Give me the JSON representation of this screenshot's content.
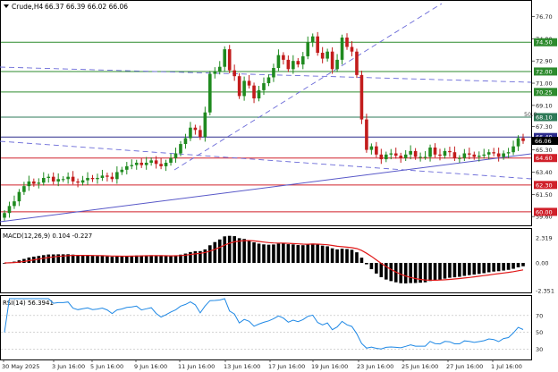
{
  "header": {
    "symbol": "Crude,H4",
    "ohlc": "66.37 66.39 66.02 66.06"
  },
  "main_axis": {
    "ticks": [
      "76.70",
      "74.80",
      "72.90",
      "71.00",
      "69.10",
      "67.30",
      "65.30",
      "63.40",
      "61.50",
      "59.60"
    ],
    "fibo_label": "50.0",
    "levels": [
      {
        "label": "74.50",
        "value": 74.5,
        "color": "#2e8b2e",
        "text_color": "#ffffff",
        "bg": "#2e8b2e"
      },
      {
        "label": "72.00",
        "value": 72.0,
        "color": "#2e8b2e",
        "text_color": "#ffffff",
        "bg": "#2e8b2e"
      },
      {
        "label": "70.25",
        "value": 70.25,
        "color": "#2e8b2e",
        "text_color": "#ffffff",
        "bg": "#2e8b2e"
      },
      {
        "label": "68.10",
        "value": 68.1,
        "color": "#2e7a58",
        "text_color": "#ffffff",
        "bg": "#2e7a58"
      },
      {
        "label": "66.40",
        "value": 66.4,
        "color": "#2b2b8c",
        "text_color": "#ffffff",
        "bg": "#2b2b8c"
      },
      {
        "label": "64.60",
        "value": 64.6,
        "color": "#d0202a",
        "text_color": "#ffffff",
        "bg": "#d0202a"
      },
      {
        "label": "62.30",
        "value": 62.3,
        "color": "#d0202a",
        "text_color": "#ffffff",
        "bg": "#d0202a"
      },
      {
        "label": "60.00",
        "value": 60.0,
        "color": "#d0202a",
        "text_color": "#ffffff",
        "bg": "#d0202a"
      }
    ],
    "current_price": "66.06"
  },
  "macd": {
    "title": "MACD(12,26,9) 0.104 -0.227",
    "ticks": [
      "2.319",
      "0.00",
      "-2.351"
    ]
  },
  "rsi": {
    "title": "RSI(14) 56.3941",
    "ticks": [
      "70",
      "50",
      "30"
    ]
  },
  "x_axis": {
    "labels": [
      "30 May 2025",
      "3 Jun 16:00",
      "5 Jun 16:00",
      "9 Jun 16:00",
      "11 Jun 16:00",
      "13 Jun 16:00",
      "17 Jun 16:00",
      "19 Jun 16:00",
      "23 Jun 16:00",
      "25 Jun 16:00",
      "27 Jun 16:00",
      "1 Jul 16:00"
    ]
  },
  "chart_data": {
    "type": "candlestick",
    "y_range": [
      59.0,
      77.5
    ],
    "candles_close": [
      59.9,
      60.5,
      60.9,
      61.7,
      62.2,
      62.6,
      62.4,
      62.5,
      62.9,
      63.0,
      62.6,
      62.8,
      62.8,
      63.0,
      62.6,
      62.5,
      62.7,
      62.9,
      62.8,
      62.9,
      63.1,
      63.0,
      62.8,
      63.4,
      63.6,
      63.9,
      64.0,
      64.2,
      64.0,
      64.2,
      64.4,
      64.1,
      63.9,
      64.2,
      64.6,
      65.0,
      65.8,
      66.3,
      67.2,
      67.0,
      66.4,
      68.5,
      71.8,
      72.0,
      72.4,
      73.9,
      72.1,
      71.6,
      69.9,
      71.2,
      70.8,
      69.7,
      70.4,
      71.0,
      71.5,
      72.3,
      73.4,
      73.0,
      72.2,
      72.9,
      72.6,
      73.3,
      74.5,
      75.0,
      73.6,
      73.1,
      73.7,
      72.2,
      73.0,
      74.9,
      74.1,
      73.7,
      71.7,
      67.9,
      65.3,
      65.6,
      64.9,
      64.5,
      64.9,
      65.0,
      64.8,
      64.6,
      64.9,
      65.2,
      64.7,
      64.7,
      64.7,
      65.5,
      64.9,
      64.8,
      65.2,
      65.1,
      64.6,
      64.6,
      65.0,
      64.9,
      64.7,
      64.8,
      64.9,
      65.1,
      65.0,
      64.7,
      65.0,
      65.1,
      65.6,
      66.3,
      66.06
    ],
    "macd_histogram": "computed",
    "rsi_range": [
      20,
      90
    ]
  },
  "colors": {
    "bull": "#1f8a1f",
    "bear": "#c21c1c",
    "trend_dashed": "#6a6ad8",
    "trend_solid": "#5858c8",
    "macd_signal": "#e01818",
    "rsi_line": "#1e88e5",
    "grid_text": "#222222"
  }
}
